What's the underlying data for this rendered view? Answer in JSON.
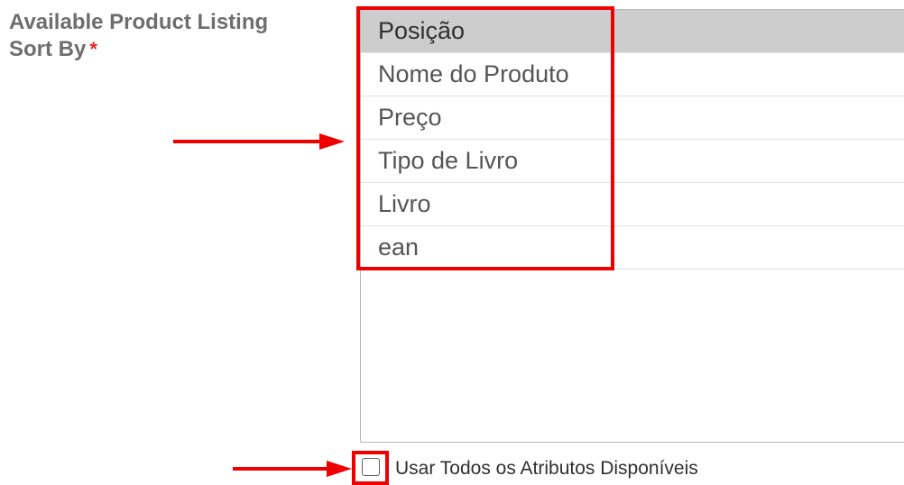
{
  "field": {
    "label_line1": "Available Product Listing",
    "label_line2": "Sort By",
    "required_mark": "*"
  },
  "sort_options": [
    {
      "label": "Posição",
      "selected": true
    },
    {
      "label": "Nome do Produto",
      "selected": false
    },
    {
      "label": "Preço",
      "selected": false
    },
    {
      "label": "Tipo de Livro",
      "selected": false
    },
    {
      "label": "Livro",
      "selected": false
    },
    {
      "label": "ean",
      "selected": false
    }
  ],
  "use_all": {
    "label": "Usar Todos os Atributos Disponíveis",
    "checked": false
  },
  "annotations": {
    "highlight_color": "#ee0000",
    "arrow_icon": "right-arrow-icon"
  }
}
